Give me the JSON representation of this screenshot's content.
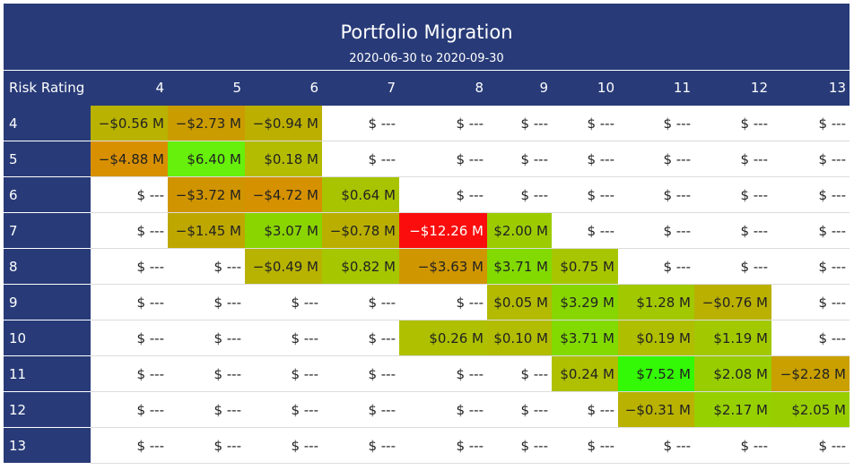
{
  "title": "Portfolio Migration",
  "subtitle": "2020-06-30 to 2020-09-30",
  "corner_label": "Risk Rating",
  "columns": [
    "4",
    "5",
    "6",
    "7",
    "8",
    "9",
    "10",
    "11",
    "12",
    "13"
  ],
  "rows": [
    {
      "label": "4",
      "cells": [
        {
          "text": "−$0.56 M",
          "color": "#b9b200"
        },
        {
          "text": "−$2.73 M",
          "color": "#cb9c00"
        },
        {
          "text": "−$0.94 M",
          "color": "#bcaf00"
        },
        {
          "text": "$ ---",
          "color": ""
        },
        {
          "text": "$ ---",
          "color": ""
        },
        {
          "text": "$ ---",
          "color": ""
        },
        {
          "text": "$ ---",
          "color": ""
        },
        {
          "text": "$ ---",
          "color": ""
        },
        {
          "text": "$ ---",
          "color": ""
        },
        {
          "text": "$ ---",
          "color": ""
        }
      ]
    },
    {
      "label": "5",
      "cells": [
        {
          "text": "−$4.88 M",
          "color": "#d99000"
        },
        {
          "text": "$6.40 M",
          "color": "#66f00c"
        },
        {
          "text": "$0.18 M",
          "color": "#b3bc00"
        },
        {
          "text": "$ ---",
          "color": ""
        },
        {
          "text": "$ ---",
          "color": ""
        },
        {
          "text": "$ ---",
          "color": ""
        },
        {
          "text": "$ ---",
          "color": ""
        },
        {
          "text": "$ ---",
          "color": ""
        },
        {
          "text": "$ ---",
          "color": ""
        },
        {
          "text": "$ ---",
          "color": ""
        }
      ]
    },
    {
      "label": "6",
      "cells": [
        {
          "text": "$ ---",
          "color": ""
        },
        {
          "text": "−$3.72 M",
          "color": "#d09400"
        },
        {
          "text": "−$4.72 M",
          "color": "#d69100"
        },
        {
          "text": "$0.64 M",
          "color": "#a8c400"
        },
        {
          "text": "$ ---",
          "color": ""
        },
        {
          "text": "$ ---",
          "color": ""
        },
        {
          "text": "$ ---",
          "color": ""
        },
        {
          "text": "$ ---",
          "color": ""
        },
        {
          "text": "$ ---",
          "color": ""
        },
        {
          "text": "$ ---",
          "color": ""
        }
      ]
    },
    {
      "label": "7",
      "cells": [
        {
          "text": "$ ---",
          "color": ""
        },
        {
          "text": "−$1.45 M",
          "color": "#bea800"
        },
        {
          "text": "$3.07 M",
          "color": "#8ad400"
        },
        {
          "text": "−$0.78 M",
          "color": "#baaf00"
        },
        {
          "text": "−$12.26 M",
          "color": "#fb0d0d",
          "dark": true
        },
        {
          "text": "$2.00 M",
          "color": "#9ccc00"
        },
        {
          "text": "$ ---",
          "color": ""
        },
        {
          "text": "$ ---",
          "color": ""
        },
        {
          "text": "$ ---",
          "color": ""
        },
        {
          "text": "$ ---",
          "color": ""
        }
      ]
    },
    {
      "label": "8",
      "cells": [
        {
          "text": "$ ---",
          "color": ""
        },
        {
          "text": "$ ---",
          "color": ""
        },
        {
          "text": "−$0.49 M",
          "color": "#b8b300"
        },
        {
          "text": "$0.82 M",
          "color": "#a6c600"
        },
        {
          "text": "−$3.63 M",
          "color": "#d09600"
        },
        {
          "text": "$3.71 M",
          "color": "#82da00"
        },
        {
          "text": "$0.75 M",
          "color": "#a8c600"
        },
        {
          "text": "$ ---",
          "color": ""
        },
        {
          "text": "$ ---",
          "color": ""
        },
        {
          "text": "$ ---",
          "color": ""
        }
      ]
    },
    {
      "label": "9",
      "cells": [
        {
          "text": "$ ---",
          "color": ""
        },
        {
          "text": "$ ---",
          "color": ""
        },
        {
          "text": "$ ---",
          "color": ""
        },
        {
          "text": "$ ---",
          "color": ""
        },
        {
          "text": "$ ---",
          "color": ""
        },
        {
          "text": "$0.05 M",
          "color": "#b3ba00"
        },
        {
          "text": "$3.29 M",
          "color": "#88d600"
        },
        {
          "text": "$1.28 M",
          "color": "#a2c800"
        },
        {
          "text": "−$0.76 M",
          "color": "#bab000"
        },
        {
          "text": "$ ---",
          "color": ""
        }
      ]
    },
    {
      "label": "10",
      "cells": [
        {
          "text": "$ ---",
          "color": ""
        },
        {
          "text": "$ ---",
          "color": ""
        },
        {
          "text": "$ ---",
          "color": ""
        },
        {
          "text": "$ ---",
          "color": ""
        },
        {
          "text": "$0.26 M",
          "color": "#aec000"
        },
        {
          "text": "$0.10 M",
          "color": "#b2bc00"
        },
        {
          "text": "$3.71 M",
          "color": "#82da00"
        },
        {
          "text": "$0.19 M",
          "color": "#b0be00"
        },
        {
          "text": "$1.19 M",
          "color": "#a2c800"
        },
        {
          "text": "$ ---",
          "color": ""
        }
      ]
    },
    {
      "label": "11",
      "cells": [
        {
          "text": "$ ---",
          "color": ""
        },
        {
          "text": "$ ---",
          "color": ""
        },
        {
          "text": "$ ---",
          "color": ""
        },
        {
          "text": "$ ---",
          "color": ""
        },
        {
          "text": "$ ---",
          "color": ""
        },
        {
          "text": "$ ---",
          "color": ""
        },
        {
          "text": "$0.24 M",
          "color": "#aec000"
        },
        {
          "text": "$7.52 M",
          "color": "#33f806"
        },
        {
          "text": "$2.08 M",
          "color": "#98ce00"
        },
        {
          "text": "−$2.28 M",
          "color": "#c9a000"
        }
      ]
    },
    {
      "label": "12",
      "cells": [
        {
          "text": "$ ---",
          "color": ""
        },
        {
          "text": "$ ---",
          "color": ""
        },
        {
          "text": "$ ---",
          "color": ""
        },
        {
          "text": "$ ---",
          "color": ""
        },
        {
          "text": "$ ---",
          "color": ""
        },
        {
          "text": "$ ---",
          "color": ""
        },
        {
          "text": "$ ---",
          "color": ""
        },
        {
          "text": "−$0.31 M",
          "color": "#b9b200"
        },
        {
          "text": "$2.17 M",
          "color": "#96d000"
        },
        {
          "text": "$2.05 M",
          "color": "#98ce00"
        }
      ]
    },
    {
      "label": "13",
      "cells": [
        {
          "text": "$ ---",
          "color": ""
        },
        {
          "text": "$ ---",
          "color": ""
        },
        {
          "text": "$ ---",
          "color": ""
        },
        {
          "text": "$ ---",
          "color": ""
        },
        {
          "text": "$ ---",
          "color": ""
        },
        {
          "text": "$ ---",
          "color": ""
        },
        {
          "text": "$ ---",
          "color": ""
        },
        {
          "text": "$ ---",
          "color": ""
        },
        {
          "text": "$ ---",
          "color": ""
        },
        {
          "text": "$ ---",
          "color": ""
        }
      ]
    }
  ]
}
